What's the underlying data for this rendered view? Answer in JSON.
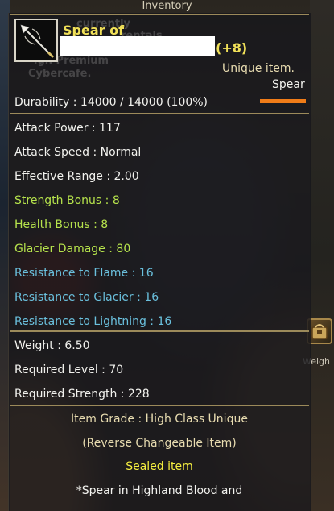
{
  "window": {
    "title": "Inventory"
  },
  "item": {
    "icon": "spear-icon",
    "name_prefix": "Spear of",
    "enchant": "(+8)",
    "rarity": "Unique item.",
    "type": "Spear",
    "durability_text": "Durability : 14000 / 14000 (100%)",
    "durability_fraction": 1.0
  },
  "stats_primary": [
    {
      "text": "Attack Power : 117",
      "color": "white"
    },
    {
      "text": "Attack Speed : Normal",
      "color": "white"
    },
    {
      "text": "Effective Range : 2.00",
      "color": "white"
    },
    {
      "text": "Strength Bonus : 8",
      "color": "green"
    },
    {
      "text": "Health Bonus : 8",
      "color": "green"
    },
    {
      "text": "Glacier Damage : 80",
      "color": "green"
    },
    {
      "text": "Resistance to Flame : 16",
      "color": "blue"
    },
    {
      "text": "Resistance to Glacier : 16",
      "color": "blue"
    },
    {
      "text": "Resistance to Lightning : 16",
      "color": "blue"
    }
  ],
  "requirements": [
    {
      "text": "Weight : 6.50"
    },
    {
      "text": "Required Level : 70"
    },
    {
      "text": "Required Strength : 228"
    }
  ],
  "footer": {
    "grade": "Item Grade : High Class Unique",
    "changeable": "(Reverse Changeable Item)",
    "sealed": "Sealed item",
    "description": "*Spear in Highland Blood and"
  },
  "background": {
    "ghost_lines": [
      "currently",
      "rentals",
      "igh Premium",
      "Cybercafe."
    ],
    "side_label": "Weigh"
  },
  "colors": {
    "white": "#f2f2ee",
    "green": "#b6e34c",
    "blue": "#6ac0dd",
    "yellow": "#f0e058",
    "durability_bar": "#f07c18",
    "divider": "#9c8a5a"
  }
}
